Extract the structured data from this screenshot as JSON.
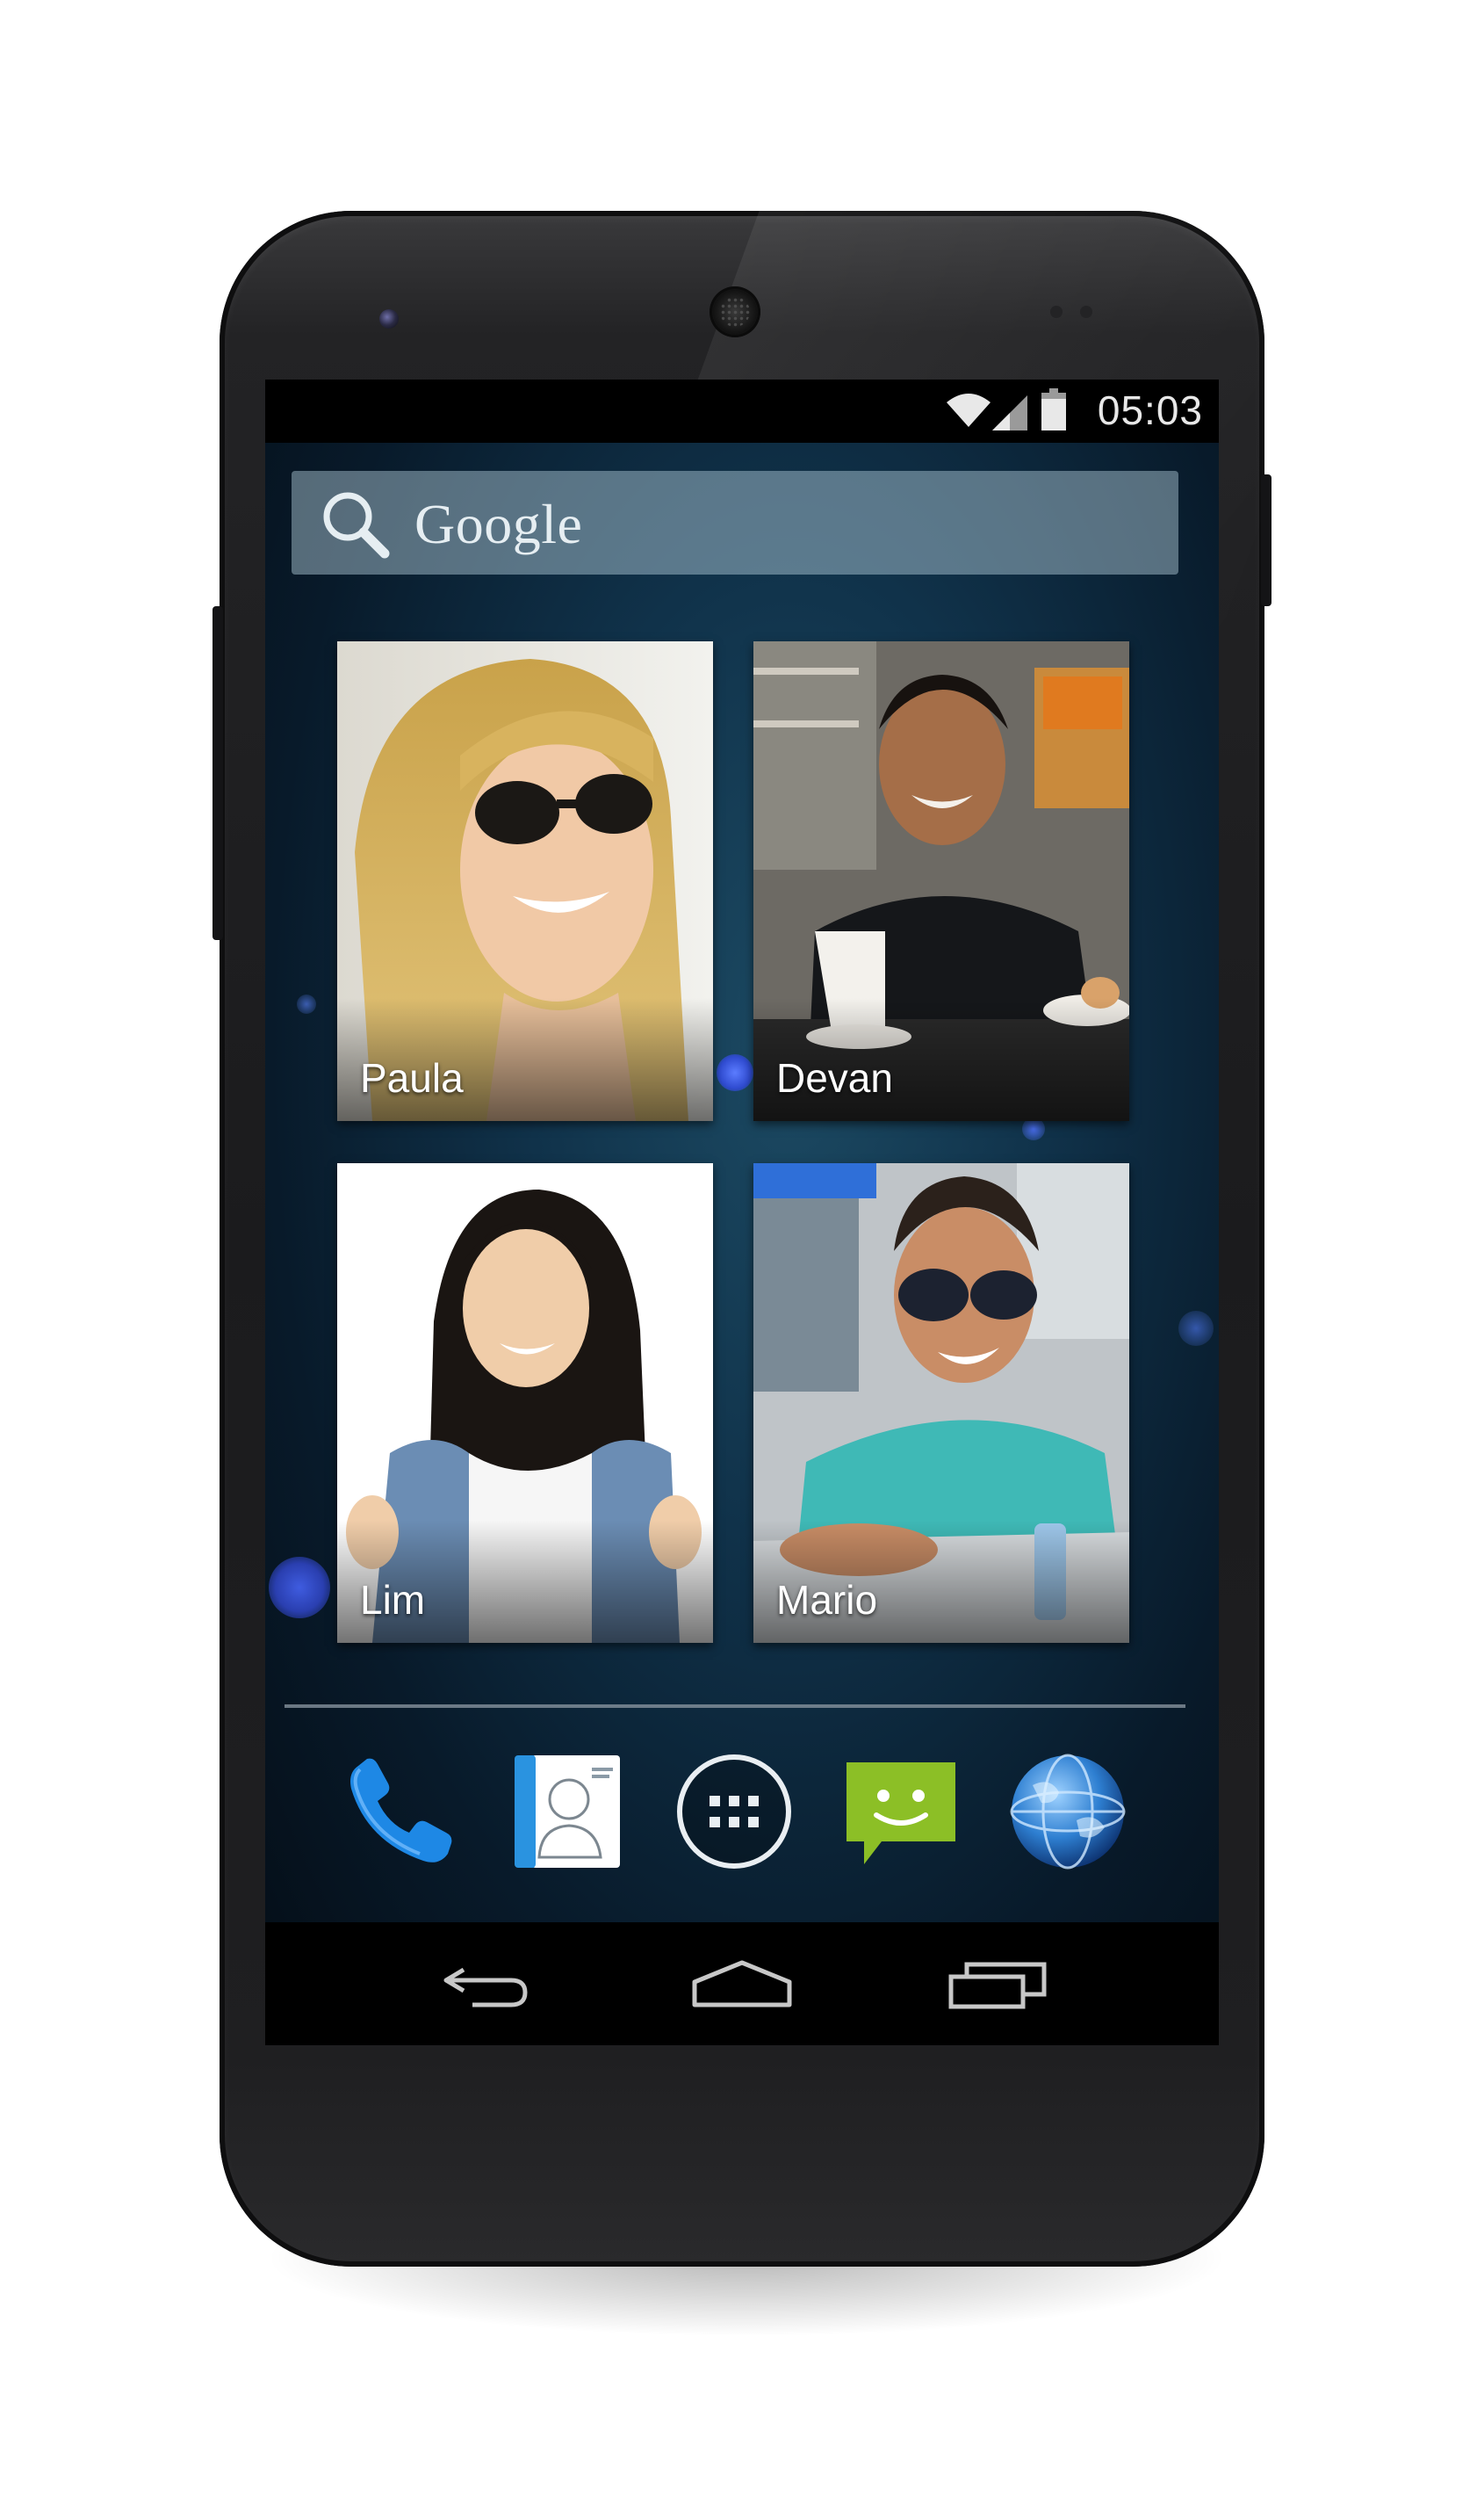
{
  "status_bar": {
    "time": "05:03",
    "icons": [
      "wifi-icon",
      "signal-icon",
      "battery-icon"
    ]
  },
  "search_widget": {
    "label": "Google",
    "icon": "search-icon"
  },
  "contacts": [
    {
      "name": "Paula"
    },
    {
      "name": "Devan"
    },
    {
      "name": "Lim"
    },
    {
      "name": "Mario"
    }
  ],
  "dock": {
    "apps": [
      "phone-icon",
      "contacts-icon",
      "app-drawer-icon",
      "messaging-icon",
      "browser-icon"
    ]
  },
  "nav_bar": {
    "buttons": [
      "back-icon",
      "home-icon",
      "recents-icon"
    ]
  },
  "colors": {
    "wallpaper": "#10324a",
    "phone_app": "#1e88e5",
    "messaging_app": "#8cbf26",
    "status_bar": "#000000"
  }
}
